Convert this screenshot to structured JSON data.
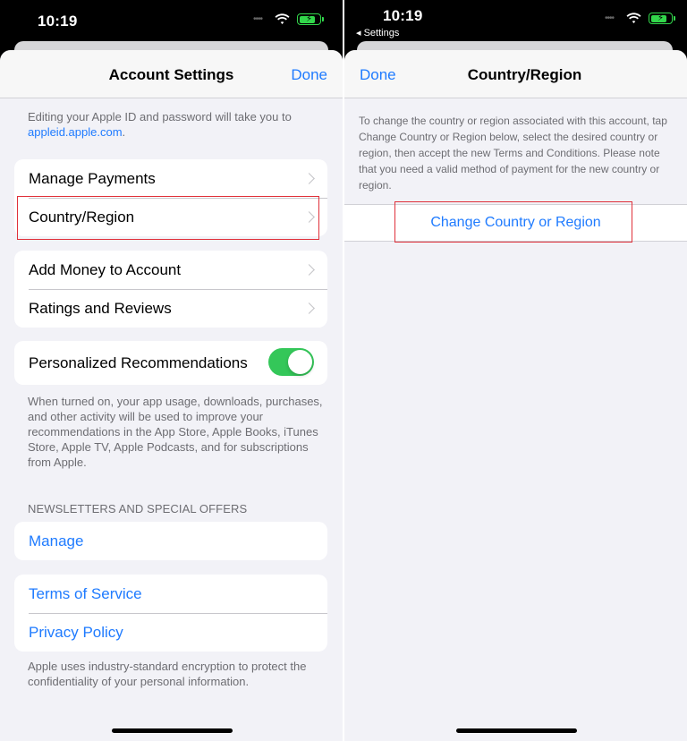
{
  "status_bar": {
    "left_time": "10:19",
    "right_time": "10:19",
    "back_label": "◂ Settings"
  },
  "account_settings": {
    "title": "Account Settings",
    "done_label": "Done",
    "apple_id_note": "Editing your Apple ID and password will take you to",
    "apple_id_link": "appleid.apple.com",
    "apple_id_suffix": ".",
    "group1": [
      {
        "label": "Manage Payments"
      },
      {
        "label": "Country/Region"
      }
    ],
    "group2": [
      {
        "label": "Add Money to Account"
      },
      {
        "label": "Ratings and Reviews"
      }
    ],
    "personalized_label": "Personalized Recommendations",
    "personalized_on": true,
    "personalized_note": "When turned on, your app usage, downloads, purchases, and other activity will be used to improve your recommendations in the App Store, Apple Books, iTunes Store, Apple TV, Apple Podcasts, and for subscriptions from Apple.",
    "newsletters_header": "NEWSLETTERS AND SPECIAL OFFERS",
    "manage_label": "Manage",
    "terms_label": "Terms of Service",
    "privacy_label": "Privacy Policy",
    "encryption_note": "Apple uses industry-standard encryption to protect the confidentiality of your personal information."
  },
  "country_region": {
    "title": "Country/Region",
    "done_label": "Done",
    "description": "To change the country or region associated with this account, tap Change Country or Region below, select the desired country or region, then accept the new Terms and Conditions. Please note that you need a valid method of payment for the new country or region.",
    "action_label": "Change Country or Region"
  },
  "colors": {
    "accent": "#1f7bff",
    "highlight": "#e0303a",
    "toggle_on": "#34c759",
    "background": "#f2f2f7"
  }
}
